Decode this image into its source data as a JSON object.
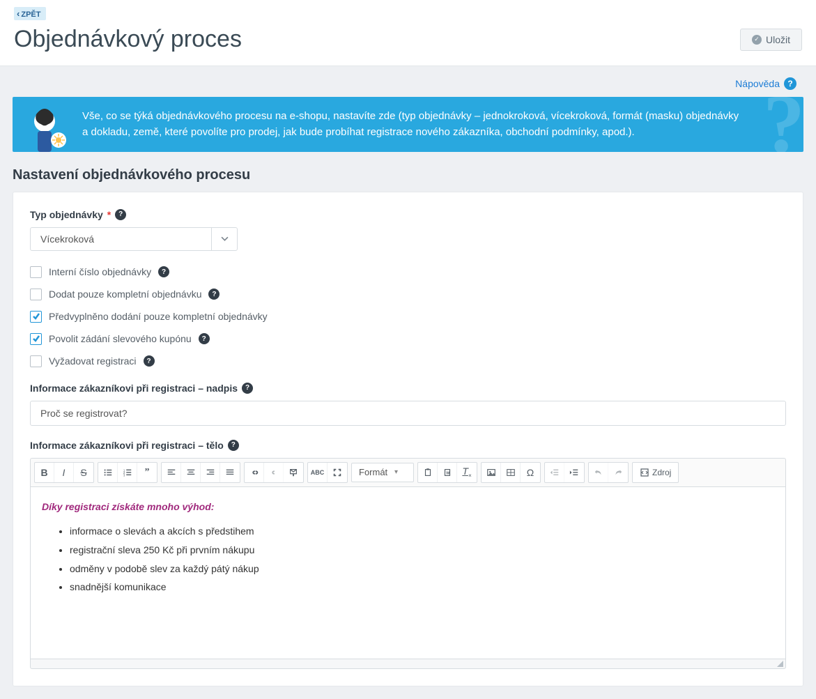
{
  "back_label": "ZPĚT",
  "page_title": "Objednávkový proces",
  "save_label": "Uložit",
  "help_label": "Nápověda",
  "info_text": "Vše, co se týká objednávkového procesu na e-shopu, nastavíte zde (typ objednávky – jednokroková, vícekroková, formát (masku) objednávky a dokladu, země, které povolíte pro prodej, jak bude probíhat registrace nového zákazníka, obchodní podmínky, apod.).",
  "section_title": "Nastavení objednávkového procesu",
  "order_type_label": "Typ objednávky",
  "order_type_value": "Vícekroková",
  "checks": {
    "internal_number": {
      "label": "Interní číslo objednávky",
      "checked": false,
      "hint": true
    },
    "complete_only": {
      "label": "Dodat pouze kompletní objednávku",
      "checked": false,
      "hint": true
    },
    "prefill_complete": {
      "label": "Předvyplněno dodání pouze kompletní objednávky",
      "checked": true,
      "hint": false
    },
    "allow_coupon": {
      "label": "Povolit zádání slevového kupónu",
      "checked": true,
      "hint": true
    },
    "require_reg": {
      "label": "Vyžadovat registraci",
      "checked": false,
      "hint": true
    }
  },
  "reg_heading_label": "Informace zákazníkovi při registraci – nadpis",
  "reg_heading_value": "Proč se registrovat?",
  "reg_body_label": "Informace zákazníkovi při registraci – tělo",
  "editor": {
    "format_label": "Formát",
    "source_label": "Zdroj",
    "content": {
      "intro": "Díky registraci získáte mnoho výhod:",
      "items": [
        "informace o slevách a akcích s předstihem",
        "registrační sleva 250 Kč při prvním nákupu",
        "odměny v podobě slev za každý pátý nákup",
        "snadnější komunikace"
      ]
    }
  }
}
